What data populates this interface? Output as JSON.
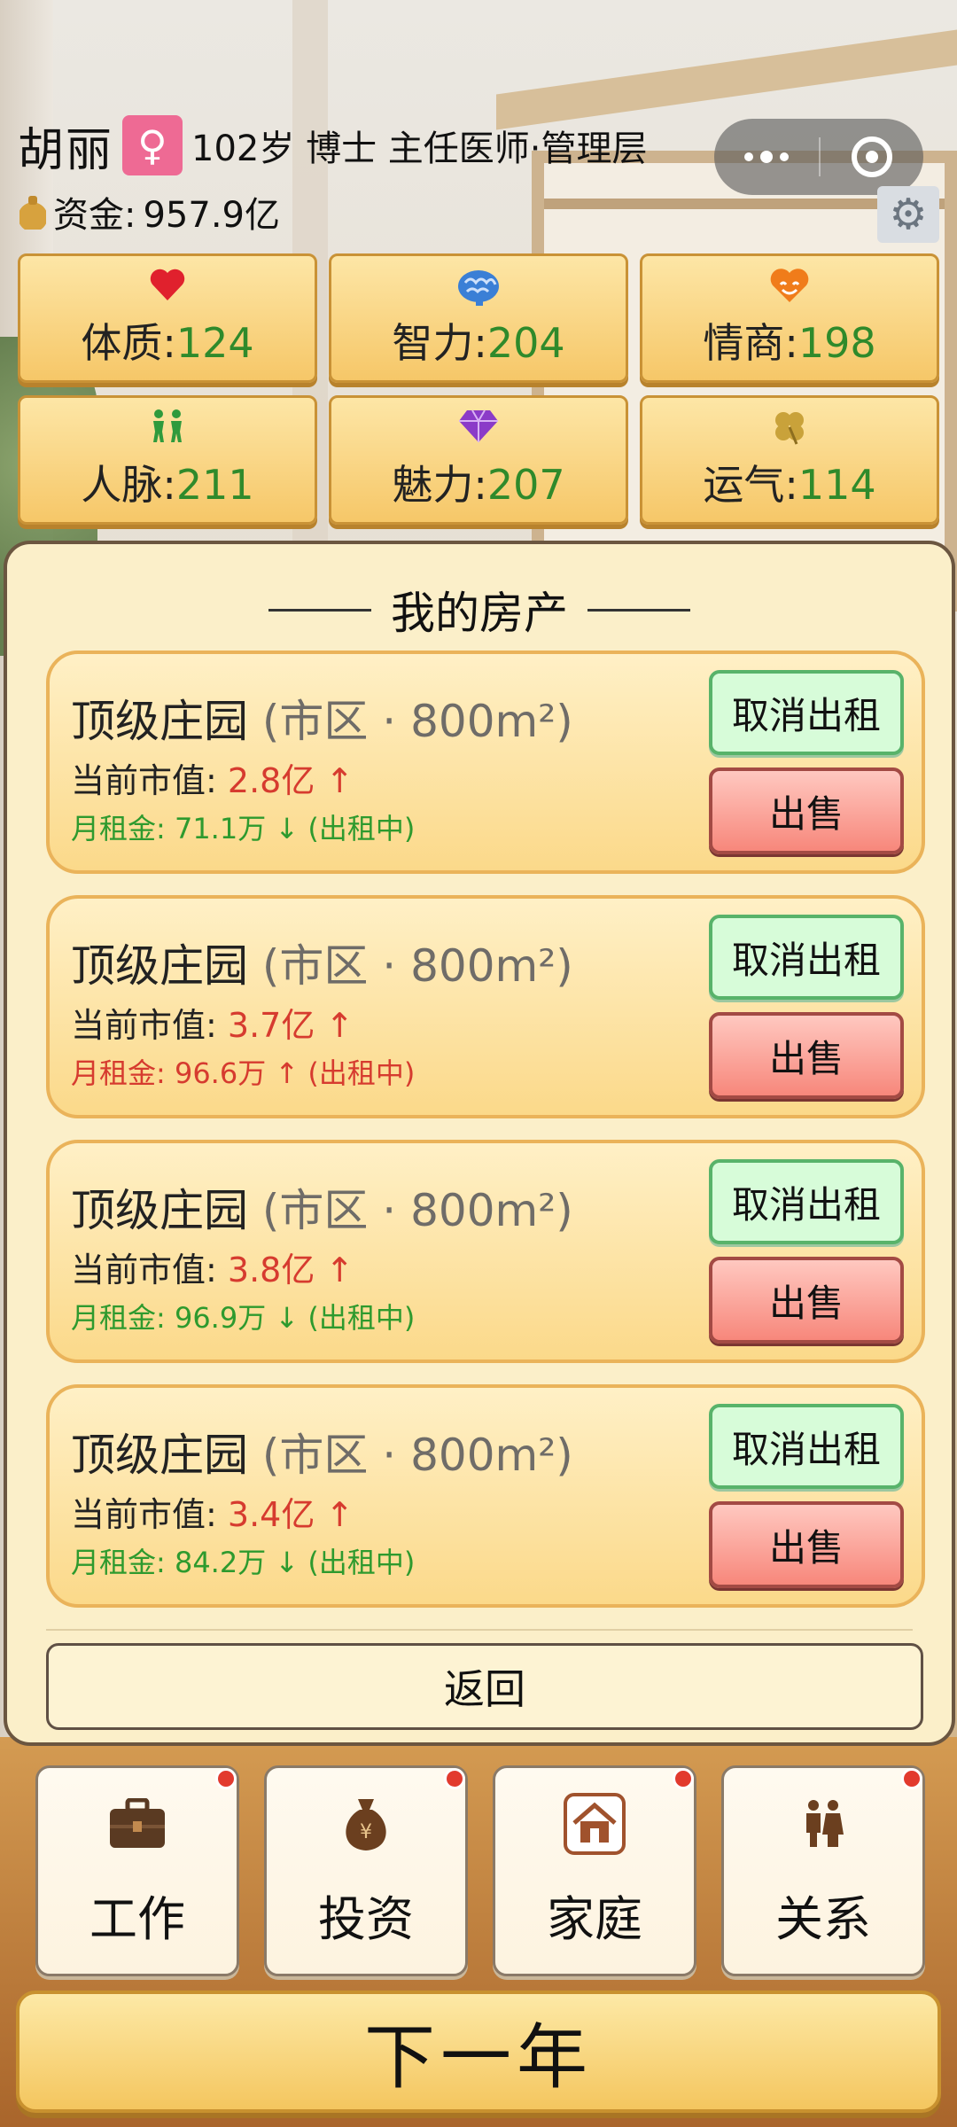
{
  "player": {
    "name": "胡丽",
    "gender_symbol": "♀",
    "description": "102岁 博士 主任医师·管理层",
    "money_label": "资金:",
    "money_value": "957.9亿"
  },
  "stats": [
    {
      "label": "体质:",
      "value": "124",
      "icon": "heart-icon",
      "color": "#e0212d"
    },
    {
      "label": "智力:",
      "value": "204",
      "icon": "brain-icon",
      "color": "#3a7fd6"
    },
    {
      "label": "情商:",
      "value": "198",
      "icon": "smile-heart-icon",
      "color": "#f07c1a"
    },
    {
      "label": "人脉:",
      "value": "211",
      "icon": "people-icon",
      "color": "#2f9a3c"
    },
    {
      "label": "魅力:",
      "value": "207",
      "icon": "diamond-icon",
      "color": "#8b3bc8"
    },
    {
      "label": "运气:",
      "value": "114",
      "icon": "clover-icon",
      "color": "#c9a23a"
    }
  ],
  "panel": {
    "title": "我的房产",
    "properties": [
      {
        "name": "顶级庄园",
        "location": "(市区 · 800m²)",
        "value_label": "当前市值:",
        "value": "2.8亿 ↑",
        "rent": "月租金: 71.1万 ↓ (出租中)",
        "rent_trend": "down",
        "cancel_label": "取消出租",
        "sell_label": "出售"
      },
      {
        "name": "顶级庄园",
        "location": "(市区 · 800m²)",
        "value_label": "当前市值:",
        "value": "3.7亿 ↑",
        "rent": "月租金: 96.6万 ↑ (出租中)",
        "rent_trend": "up",
        "cancel_label": "取消出租",
        "sell_label": "出售"
      },
      {
        "name": "顶级庄园",
        "location": "(市区 · 800m²)",
        "value_label": "当前市值:",
        "value": "3.8亿 ↑",
        "rent": "月租金: 96.9万 ↓ (出租中)",
        "rent_trend": "down",
        "cancel_label": "取消出租",
        "sell_label": "出售"
      },
      {
        "name": "顶级庄园",
        "location": "(市区 · 800m²)",
        "value_label": "当前市值:",
        "value": "3.4亿 ↑",
        "rent": "月租金: 84.2万 ↓ (出租中)",
        "rent_trend": "down",
        "cancel_label": "取消出租",
        "sell_label": "出售"
      }
    ],
    "back_label": "返回"
  },
  "nav": [
    {
      "label": "工作",
      "icon": "briefcase-icon",
      "has_badge": true
    },
    {
      "label": "投资",
      "icon": "money-bag-icon",
      "has_badge": true
    },
    {
      "label": "家庭",
      "icon": "house-icon",
      "has_badge": true
    },
    {
      "label": "关系",
      "icon": "couple-icon",
      "has_badge": true
    }
  ],
  "next_year_label": "下一年",
  "colors": {
    "stat_value": "#2f8a2b",
    "price_up": "#d63b2f",
    "rent_down": "#2e9a2e",
    "panel_bg": "#fbefc9",
    "card_border": "#eab35a",
    "badge": "#e23a2e"
  }
}
